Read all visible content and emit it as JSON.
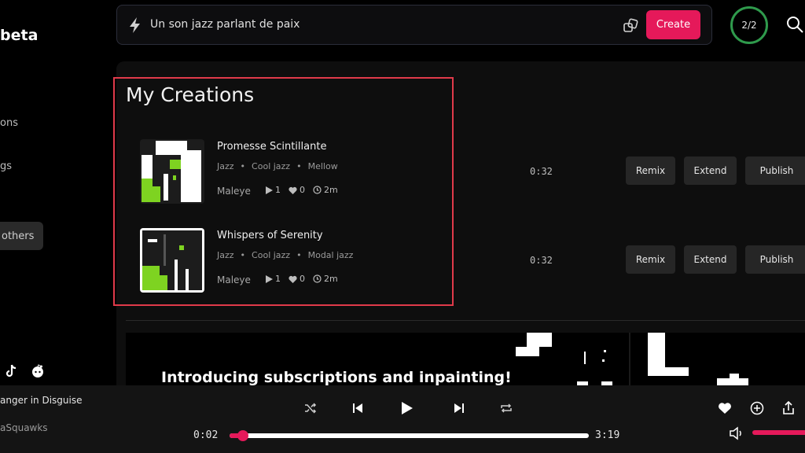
{
  "sidebar": {
    "brand": "beta",
    "items": [
      {
        "label": "ons"
      },
      {
        "label": "gs"
      }
    ],
    "others_label": "others"
  },
  "prompt": {
    "value": "Un son jazz parlant de paix",
    "create_label": "Create"
  },
  "credits": "2/2",
  "creations": {
    "title": "My Creations",
    "songs": [
      {
        "title": "Promesse Scintillante",
        "tags": [
          "Jazz",
          "Cool jazz",
          "Mellow"
        ],
        "artist": "Maleye",
        "plays": "1",
        "likes": "0",
        "age": "2m",
        "duration": "0:32",
        "actions": [
          "Remix",
          "Extend",
          "Publish"
        ]
      },
      {
        "title": "Whispers of Serenity",
        "tags": [
          "Jazz",
          "Cool jazz",
          "Modal jazz"
        ],
        "artist": "Maleye",
        "plays": "1",
        "likes": "0",
        "age": "2m",
        "duration": "0:32",
        "actions": [
          "Remix",
          "Extend",
          "Publish"
        ]
      }
    ]
  },
  "banner": {
    "title": "Introducing subscriptions and inpainting!"
  },
  "player": {
    "title": "anger in Disguise",
    "artist": "aSquawks",
    "elapsed": "0:02",
    "total": "3:19",
    "progress": 0.01,
    "volume": 1.0
  },
  "colors": {
    "accent": "#e5195a",
    "highlight_border": "#e03a4a",
    "credits_ring": "#2f9a4c"
  }
}
